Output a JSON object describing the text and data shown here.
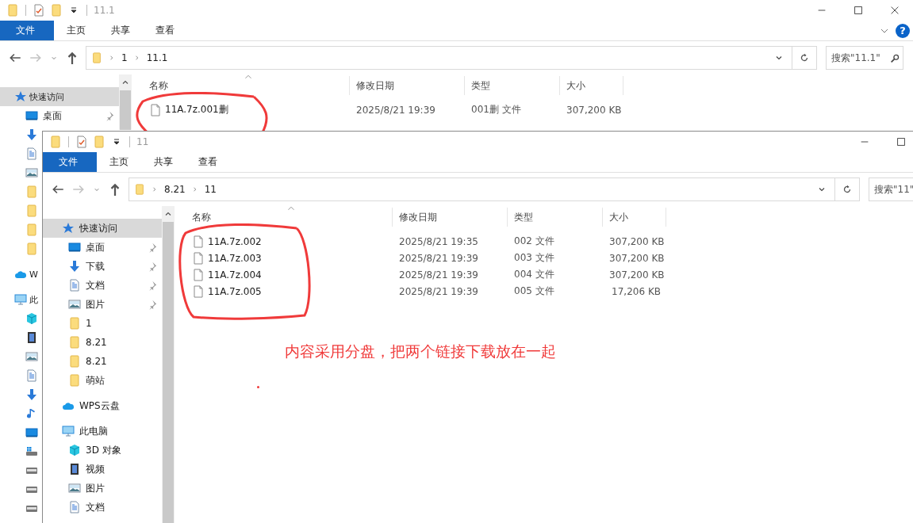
{
  "windows": [
    {
      "title": "11.1",
      "window_buttons": [
        {
          "kind": "minimize"
        },
        {
          "kind": "maximize"
        },
        {
          "kind": "close"
        }
      ],
      "tabs": [
        {
          "label": "文件",
          "selected": true
        },
        {
          "label": "主页",
          "selected": false
        },
        {
          "label": "共享",
          "selected": false
        },
        {
          "label": "查看",
          "selected": false
        }
      ],
      "help_button": "?",
      "nav_forward_enabled": false,
      "breadcrumb": [
        "1",
        "11.1"
      ],
      "search": {
        "placeholder": "搜索\"11.1\""
      },
      "sidebar": [
        {
          "label": "快速访问",
          "kind": "star",
          "selected": true,
          "children": [
            {
              "label": "桌面",
              "kind": "desktop",
              "pinned": true,
              "selected": false
            },
            {
              "kind": "download",
              "pinned": false,
              "selected": false
            },
            {
              "kind": "document",
              "pinned": false,
              "selected": false
            },
            {
              "kind": "picture",
              "pinned": false,
              "selected": false
            },
            {
              "kind": "folder",
              "pinned": false,
              "selected": false
            },
            {
              "kind": "folder",
              "pinned": false,
              "selected": false
            },
            {
              "kind": "folder",
              "pinned": false,
              "selected": false
            },
            {
              "kind": "folder",
              "pinned": false,
              "selected": false
            }
          ]
        },
        {
          "label": "W",
          "kind": "cloud",
          "selected": false
        },
        {
          "label": "此",
          "kind": "computer",
          "selected": false,
          "children": [
            {
              "kind": "cube",
              "selected": false
            },
            {
              "kind": "video",
              "selected": false
            },
            {
              "kind": "picture",
              "selected": false
            },
            {
              "kind": "document",
              "selected": false
            },
            {
              "kind": "download",
              "selected": false
            },
            {
              "kind": "music",
              "selected": false
            },
            {
              "kind": "desktop",
              "selected": false
            },
            {
              "kind": "system-drive",
              "selected": false
            },
            {
              "kind": "drive",
              "selected": false
            },
            {
              "kind": "drive",
              "selected": false
            },
            {
              "kind": "drive",
              "selected": false
            }
          ]
        }
      ],
      "columns": [
        "名称",
        "修改日期",
        "类型",
        "大小"
      ],
      "files": [
        {
          "name": "11A.7z.001删",
          "date": "2025/8/21 19:39",
          "type": "001删 文件",
          "size": "307,200 KB"
        }
      ],
      "files_circled": true
    },
    {
      "title": "11",
      "window_buttons": [
        {
          "kind": "minimize"
        },
        {
          "kind": "maximize"
        }
      ],
      "tabs": [
        {
          "label": "文件",
          "selected": true
        },
        {
          "label": "主页",
          "selected": false
        },
        {
          "label": "共享",
          "selected": false
        },
        {
          "label": "查看",
          "selected": false
        }
      ],
      "nav_forward_enabled": false,
      "breadcrumb": [
        "8.21",
        "11"
      ],
      "search": {
        "placeholder": "搜索\"11\""
      },
      "sidebar": [
        {
          "label": "快速访问",
          "kind": "star",
          "selected": true,
          "children": [
            {
              "label": "桌面",
              "kind": "desktop",
              "pinned": true,
              "selected": false
            },
            {
              "label": "下载",
              "kind": "download",
              "pinned": true,
              "selected": false
            },
            {
              "label": "文档",
              "kind": "document",
              "pinned": true,
              "selected": false
            },
            {
              "label": "图片",
              "kind": "picture",
              "pinned": true,
              "selected": false
            },
            {
              "label": "1",
              "kind": "folder",
              "pinned": false,
              "selected": false
            },
            {
              "label": "8.21",
              "kind": "folder",
              "pinned": false,
              "selected": false
            },
            {
              "label": "8.21",
              "kind": "folder",
              "pinned": false,
              "selected": false
            },
            {
              "label": "萌站",
              "kind": "folder",
              "pinned": false,
              "selected": false
            }
          ]
        },
        {
          "label": "WPS云盘",
          "kind": "cloud",
          "selected": false
        },
        {
          "label": "此电脑",
          "kind": "computer",
          "selected": false,
          "children": [
            {
              "label": "3D 对象",
              "kind": "cube",
              "selected": false
            },
            {
              "label": "视频",
              "kind": "video",
              "selected": false
            },
            {
              "label": "图片",
              "kind": "picture",
              "selected": false
            },
            {
              "label": "文档",
              "kind": "document",
              "selected": false
            }
          ]
        }
      ],
      "columns": [
        "名称",
        "修改日期",
        "类型",
        "大小"
      ],
      "files": [
        {
          "name": "11A.7z.002",
          "date": "2025/8/21 19:35",
          "type": "002 文件",
          "size": "307,200 KB"
        },
        {
          "name": "11A.7z.003",
          "date": "2025/8/21 19:39",
          "type": "003 文件",
          "size": "307,200 KB"
        },
        {
          "name": "11A.7z.004",
          "date": "2025/8/21 19:39",
          "type": "004 文件",
          "size": "307,200 KB"
        },
        {
          "name": "11A.7z.005",
          "date": "2025/8/21 19:39",
          "type": "005 文件",
          "size": "17,206 KB"
        }
      ],
      "files_circled": true,
      "note": "内容采用分盘，把两个链接下载放在一起"
    }
  ]
}
